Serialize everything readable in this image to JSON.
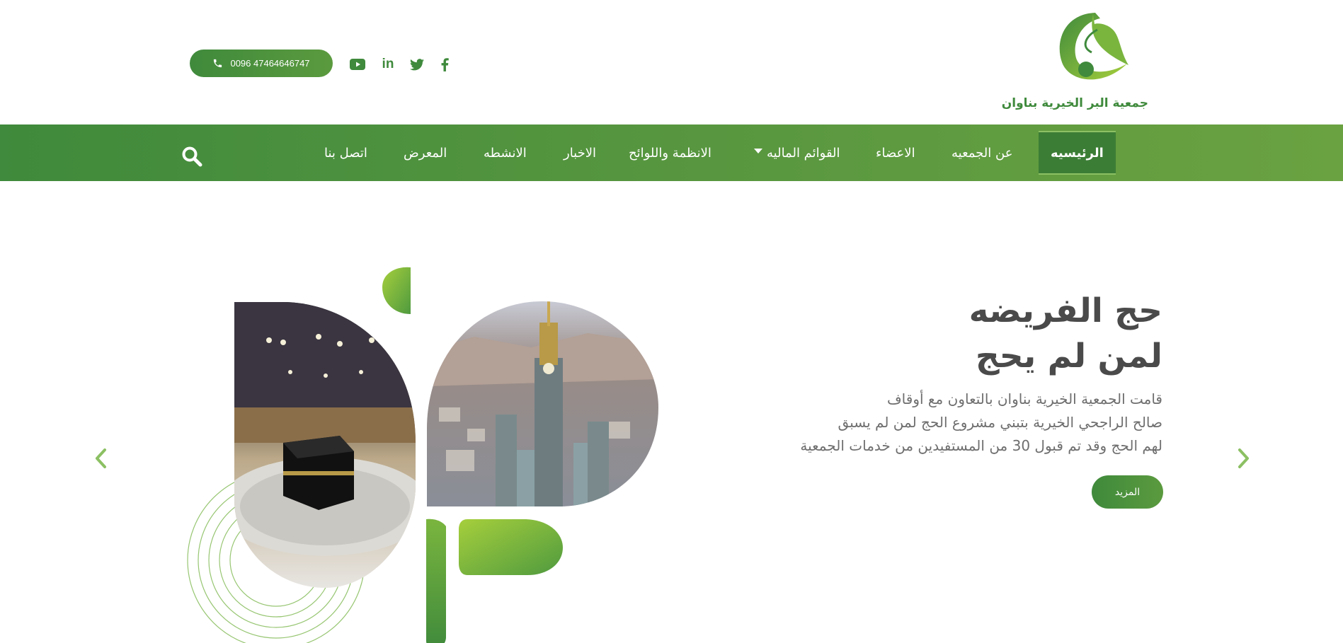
{
  "header": {
    "logo_text": "جمعية البر الخيرية بناوان",
    "phone": "0096 47464646747",
    "social_icons": [
      "youtube-icon",
      "linkedin-icon",
      "twitter-icon",
      "facebook-icon"
    ],
    "social_labels": {
      "linkedin": "in"
    }
  },
  "nav": {
    "items": [
      {
        "label": "الرئيسيه",
        "active": true
      },
      {
        "label": "عن الجمعيه"
      },
      {
        "label": "الاعضاء"
      },
      {
        "label": "القوائم الماليه",
        "has_dropdown": true
      },
      {
        "label": "الانظمة واللوائح"
      },
      {
        "label": "الاخبار"
      },
      {
        "label": "الانشطه"
      },
      {
        "label": "المعرض"
      },
      {
        "label": "اتصل بنا"
      }
    ]
  },
  "hero": {
    "title_line1": "حج الفريضه",
    "title_line2": "لمن لم يحج",
    "desc_line1": "قامت الجمعية الخيرية بناوان بالتعاون مع أوقاف",
    "desc_line2": "صالح الراجحي الخيرية بتبني مشروع الحج لمن لم يسبق",
    "desc_line3": "لهم الحج وقد تم قبول 30 من المستفيدين من خدمات الجمعية",
    "more_label": "المزيد"
  },
  "colors": {
    "brand_green": "#3f8a3c",
    "light_green": "#8cc063",
    "title_gray": "#4a4a4a"
  }
}
